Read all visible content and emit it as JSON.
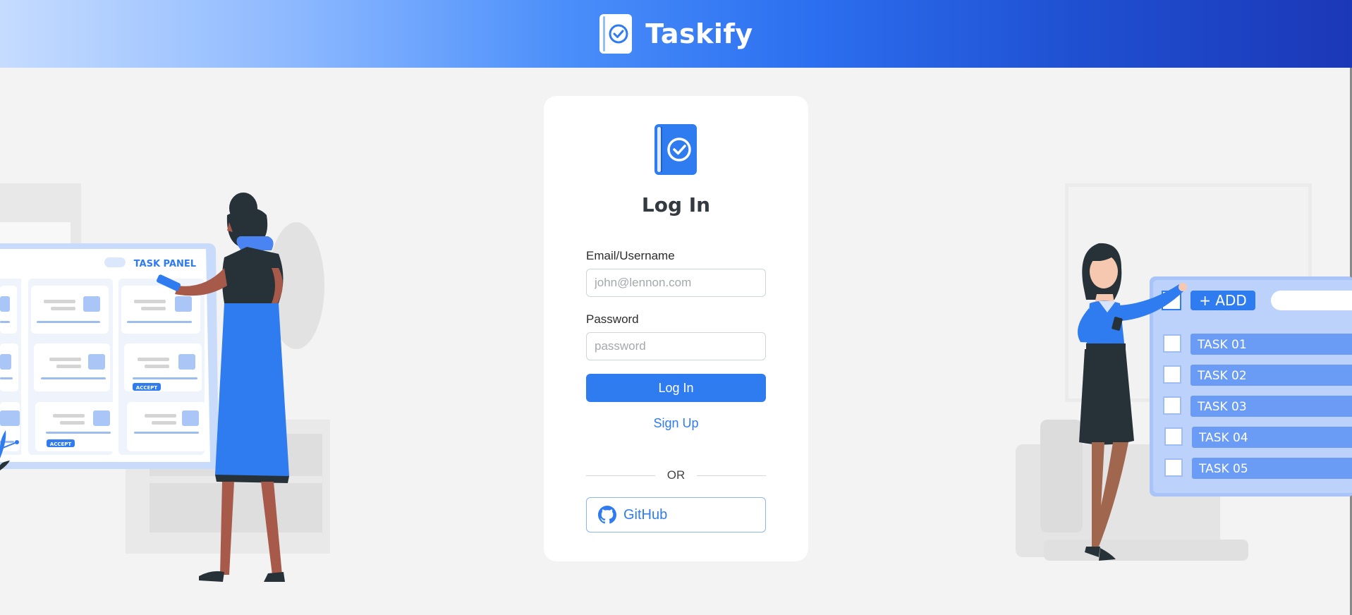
{
  "header": {
    "brand_name": "Taskify"
  },
  "login": {
    "title": "Log In",
    "email_label": "Email/Username",
    "email_placeholder": "john@lennon.com",
    "email_value": "",
    "password_label": "Password",
    "password_placeholder": "password",
    "password_value": "",
    "submit_label": "Log In",
    "signup_label": "Sign Up",
    "divider_label": "OR",
    "github_label": "GitHub"
  },
  "illustration_left": {
    "panel_title": "TASK PANEL",
    "accept_badge": "ACCEPT"
  },
  "illustration_right": {
    "add_button": "+ ADD",
    "tasks": [
      "TASK 01",
      "TASK 02",
      "TASK 03",
      "TASK 04",
      "TASK 05"
    ]
  },
  "icons": {
    "brand_logo": "check-book-icon",
    "github": "github-icon"
  },
  "colors": {
    "accent": "#2f7bf0",
    "header_gradient_start": "#c6dcff",
    "header_gradient_end": "#1b38b8",
    "background": "#f3f3f3",
    "card": "#ffffff"
  }
}
